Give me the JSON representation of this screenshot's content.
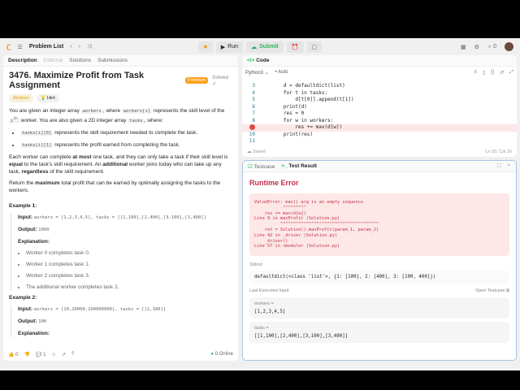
{
  "nav": {
    "problem_list": "Problem List",
    "run": "Run",
    "submit": "Submit",
    "streak": "0"
  },
  "left": {
    "tabs": [
      "Description",
      "Editorial",
      "Solutions",
      "Submissions"
    ],
    "title": "3476. Maximize Profit from Task Assignment",
    "premium": "Premium",
    "solved": "Solved",
    "difficulty": "Medium",
    "hint": "Hint",
    "p1a": "You are given an integer array ",
    "p1b": "workers",
    ", where ": "",
    "p1c": ", where ",
    "p1d": "workers[i]",
    "p1e": " represents the skill level of the ",
    "p1f": "i",
    "p1g": "th",
    "p1h": " worker. You are also given a 2D integer array ",
    "p1i": "tasks",
    "p1j": ", where:",
    "b1code": "tasks[i][0]",
    "b1": " represents the skill requirement needed to complete the task.",
    "b2code": "tasks[i][1]",
    "b2": " represents the profit earned from completing the task.",
    "p2a": "Each worker can complete ",
    "p2b": "at most",
    "p2c": " one task, and they can only take a task if their skill level is ",
    "p2d": "equal",
    "p2e": " to the task's skill requirement. An ",
    "p2f": "additional",
    "p2g": " worker joins today who can take up any task, ",
    "p2h": "regardless",
    "p2i": " of the skill requirement.",
    "p3a": "Return the ",
    "p3b": "maximum",
    "p3c": " total profit that can be earned by optimally assigning the tasks to the workers.",
    "ex1": {
      "title": "Example 1:",
      "input_label": "Input:",
      "input": "workers = [1,2,3,4,5], tasks = [[1,100],[2,400],[3,100],[3,400]]",
      "output_label": "Output:",
      "output": "1000",
      "expl_label": "Explanation:",
      "expl": [
        "Worker 0 completes task 0.",
        "Worker 1 completes task 1.",
        "Worker 2 completes task 3.",
        "The additional worker completes task 2."
      ]
    },
    "ex2": {
      "title": "Example 2:",
      "input_label": "Input:",
      "input": "workers = [10,10000,100000000], tasks = [[1,100]]",
      "output_label": "Output:",
      "output": "100",
      "expl_label": "Explanation:"
    },
    "footer": {
      "likes": "0",
      "comments": "1",
      "online": "0 Online"
    }
  },
  "code": {
    "tab": "Code",
    "lang": "Python3",
    "auto": "Auto",
    "saved": "Saved",
    "cursor": "Ln 10, Col 16",
    "lines": [
      {
        "n": "3",
        "t": "        d = defaultdict(list)"
      },
      {
        "n": "4",
        "t": "        for t in tasks:"
      },
      {
        "n": "5",
        "t": "            d[t[0]].append(t[1])"
      },
      {
        "n": "6",
        "t": "        print(d)"
      },
      {
        "n": "7",
        "t": "        res = 0"
      },
      {
        "n": "8",
        "t": "        for w in workers:"
      },
      {
        "n": "9",
        "t": "            res += max(d[w])"
      },
      {
        "n": "10",
        "t": "        print(res)"
      },
      {
        "n": "11",
        "t": ""
      }
    ]
  },
  "result": {
    "tabs": [
      "Testcase",
      "Test Result"
    ],
    "status": "Runtime Error",
    "error": "ValueError: max() arg is an empty sequence\n           ^^^^^^^^^\n    res += max(d[w])\nLine 9 in maxProfit (Solution.py)\n          ^^^^^^^^^^^^^^^^^^^^^^^^^^^^^^^^^^^^^^\n    ret = Solution().maxProfit(param_1, param_2)\nLine 42 in _driver (Solution.py)\n    _driver()\nLine 57 in <module> (Solution.py)",
    "stdout_label": "Stdout",
    "stdout": "defaultdict(<class 'list'>, {1: [100], 2: [400], 3: [100, 400]})",
    "last_input_label": "Last Executed Input",
    "open_testcase": "Open Testcase",
    "inputs": [
      {
        "name": "workers =",
        "value": "[1,2,3,4,5]"
      },
      {
        "name": "tasks =",
        "value": "[[1,100],[2,400],[3,100],[3,400]]"
      }
    ]
  }
}
